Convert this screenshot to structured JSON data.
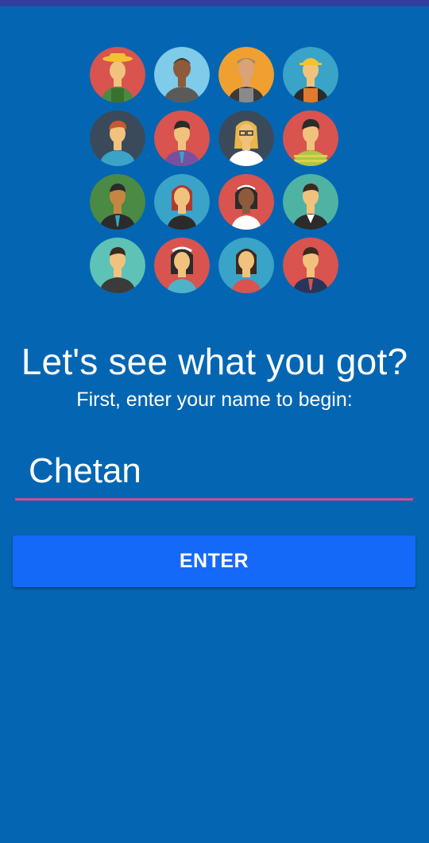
{
  "colors": {
    "background": "#0466b2",
    "status_strip": "#303f9f",
    "button": "#1569f8",
    "input_underline": "#cc4f8f",
    "text": "#ffffff"
  },
  "avatars": [
    {
      "icon": "farmer-avatar-icon",
      "bg": "#d9534f"
    },
    {
      "icon": "bald-man-avatar-icon",
      "bg": "#7ecbea"
    },
    {
      "icon": "mechanic-avatar-icon",
      "bg": "#f0a030"
    },
    {
      "icon": "construction-worker-avatar-icon",
      "bg": "#3aa3c8"
    },
    {
      "icon": "redhead-man-avatar-icon",
      "bg": "#3b4a5a"
    },
    {
      "icon": "businessman-purple-suit-avatar-icon",
      "bg": "#d9534f"
    },
    {
      "icon": "blonde-woman-glasses-avatar-icon",
      "bg": "#3b4a5a"
    },
    {
      "icon": "man-striped-shirt-avatar-icon",
      "bg": "#d9534f"
    },
    {
      "icon": "man-black-suit-avatar-icon",
      "bg": "#4a8a44"
    },
    {
      "icon": "redhead-woman-avatar-icon",
      "bg": "#3aa3c8"
    },
    {
      "icon": "woman-headband-avatar-icon",
      "bg": "#d9534f"
    },
    {
      "icon": "man-tuxedo-avatar-icon",
      "bg": "#4fb3a3"
    },
    {
      "icon": "young-man-avatar-icon",
      "bg": "#5ec2b6"
    },
    {
      "icon": "bride-avatar-icon",
      "bg": "#d9534f"
    },
    {
      "icon": "woman-red-dress-avatar-icon",
      "bg": "#3aa3c8"
    },
    {
      "icon": "man-navy-suit-avatar-icon",
      "bg": "#d9534f"
    }
  ],
  "headline": "Let's see what you got?",
  "subtitle": "First, enter your name to begin:",
  "name_input": {
    "value": "Chetan"
  },
  "enter_button": {
    "label": "ENTER"
  }
}
